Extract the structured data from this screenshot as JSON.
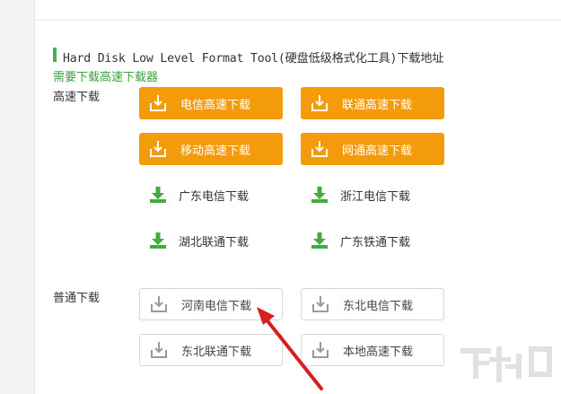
{
  "title": "Hard Disk Low Level Format Tool(硬盘低级格式化工具)下载地址",
  "link_text": "需要下载高速下载器",
  "high_speed": {
    "label": "高速下载",
    "buttons": [
      "电信高速下载",
      "联通高速下载",
      "移动高速下载",
      "网通高速下载"
    ],
    "mirrors": [
      "广东电信下载",
      "浙江电信下载",
      "湖北联通下载",
      "广东铁通下载"
    ]
  },
  "normal": {
    "label": "普通下载",
    "buttons": [
      "河南电信下载",
      "东北电信下载",
      "东北联通下载",
      "本地高速下载"
    ]
  },
  "colors": {
    "accent_orange": "#f49b0b",
    "green": "#4caf50",
    "arrow_red": "#d71f1f"
  },
  "watermark": "下载吧"
}
